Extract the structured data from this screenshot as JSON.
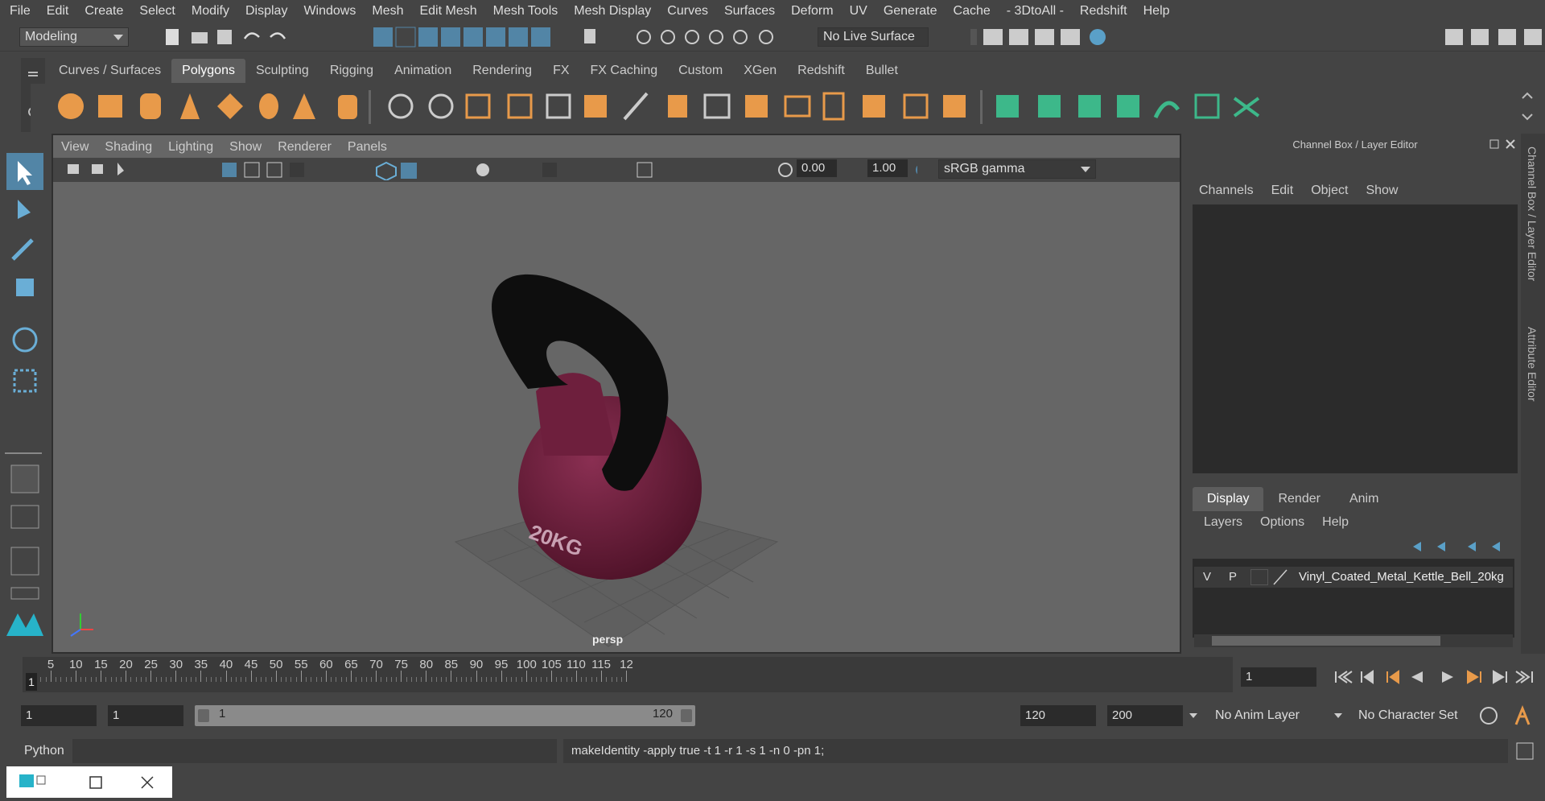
{
  "menu": [
    "File",
    "Edit",
    "Create",
    "Select",
    "Modify",
    "Display",
    "Windows",
    "Mesh",
    "Edit Mesh",
    "Mesh Tools",
    "Mesh Display",
    "Curves",
    "Surfaces",
    "Deform",
    "UV",
    "Generate",
    "Cache",
    "- 3DtoAll -",
    "Redshift",
    "Help"
  ],
  "status": {
    "mode": "Modeling",
    "live_surface": "No Live Surface"
  },
  "shelf_tabs": [
    "Curves / Surfaces",
    "Polygons",
    "Sculpting",
    "Rigging",
    "Animation",
    "Rendering",
    "FX",
    "FX Caching",
    "Custom",
    "XGen",
    "Redshift",
    "Bullet"
  ],
  "shelf_active": "Polygons",
  "viewport": {
    "menu": [
      "View",
      "Shading",
      "Lighting",
      "Show",
      "Renderer",
      "Panels"
    ],
    "exposure": "0.00",
    "gamma": "1.00",
    "color_space": "sRGB gamma",
    "camera_label": "persp",
    "model_text": "20KG"
  },
  "channel_box": {
    "title": "Channel Box / Layer Editor",
    "menu": [
      "Channels",
      "Edit",
      "Object",
      "Show"
    ]
  },
  "layer_editor": {
    "tabs": [
      "Display",
      "Render",
      "Anim"
    ],
    "active_tab": "Display",
    "menu": [
      "Layers",
      "Options",
      "Help"
    ],
    "layer": {
      "v": "V",
      "p": "P",
      "name": "Vinyl_Coated_Metal_Kettle_Bell_20kg"
    }
  },
  "side_tabs": [
    "Channel Box / Layer Editor",
    "Attribute Editor"
  ],
  "timeline": {
    "ticks": [
      "5",
      "10",
      "15",
      "20",
      "25",
      "30",
      "35",
      "40",
      "45",
      "50",
      "55",
      "60",
      "65",
      "70",
      "75",
      "80",
      "85",
      "90",
      "95",
      "100",
      "105",
      "110",
      "115",
      "12"
    ],
    "start_marker": "1",
    "current_frame": "1"
  },
  "range": {
    "start": "1",
    "playback_start": "1",
    "slider_start": "1",
    "slider_end": "120",
    "playback_end": "120",
    "end": "200",
    "anim_layer": "No Anim Layer",
    "character_set": "No Character Set"
  },
  "command": {
    "lang": "Python",
    "output": "makeIdentity -apply true -t 1 -r 1 -s 1 -n 0 -pn 1;"
  },
  "colors": {
    "accent": "#5285a6",
    "poly": "#e89a4a",
    "kettlebell": "#6e1f3d",
    "handle": "#0e0e0e"
  }
}
